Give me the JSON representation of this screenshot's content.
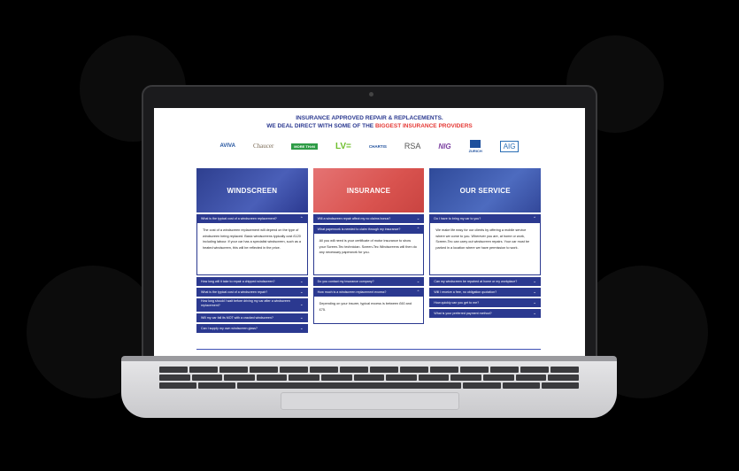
{
  "banner": {
    "line1": "INSURANCE APPROVED REPAIR & REPLACEMENTS.",
    "line2_prefix": "WE DEAL DIRECT WITH SOME OF THE",
    "line2_highlight": "BIGGEST INSURANCE PROVIDERS"
  },
  "logos": [
    {
      "label": "AVIVA",
      "color": "#1d4f9c"
    },
    {
      "label": "Chaucer",
      "color": "#7a6a55"
    },
    {
      "label": "MORE TH>N",
      "color": "#2e9c46"
    },
    {
      "label": "LV=",
      "color": "#6fbf2e"
    },
    {
      "label": "CHARTIS",
      "color": "#1d4f9c"
    },
    {
      "label": "RSA",
      "color": "#555555"
    },
    {
      "label": "NIG",
      "color": "#7b3fa0"
    },
    {
      "label": "ZURICH",
      "color": "#1d4f9c"
    },
    {
      "label": "AIG",
      "color": "#2b6fb5"
    }
  ],
  "columns": [
    {
      "title": "WINDSCREEN",
      "hero_color": "#3347a0",
      "open_question": "What is the typical cost of a windscreen replacement?",
      "answer": "The cost of a windscreen replacement will depend on the type of windscreen being replaced. Basic windscreens typically cost £120 including labour. If your car has a specialist windscreen, such as a heated windscreen, this will be reflected in the price.",
      "questions": [
        "How long will it take to repair a chipped windscreen?",
        "What is the typical cost of a windscreen repair?",
        "How long should I wait before driving my car after a windscreen replacement?",
        "Will my car fail its MOT with a cracked windscreen?",
        "Can I supply my own windscreen glass?"
      ]
    },
    {
      "title": "INSURANCE",
      "hero_color": "#e06a66",
      "pre_questions": [
        "Will a windscreen repair affect my no claims bonus?",
        "What paperwork is needed to claim through my insurance?"
      ],
      "answer": "All you will need is your certificate of motor insurance to show your Screen-Tec technician. Screen-Tec Windscreens will then do any necessary paperwork for you.",
      "questions": [
        "Do you contact my insurance company?",
        "How much is a windscreen replacement excess?"
      ],
      "answer2": "Depending on your insurer, typical excess is between £60 and £75."
    },
    {
      "title": "OUR SERVICE",
      "hero_color": "#3d5aa8",
      "open_question": "Do I have to bring my car to you?",
      "answer": "We make life easy for our clients by offering a mobile service where we come to you. Wherever you are, at home or work, Screen-Tec can carry out windscreen repairs. Your car must be parked in a location where we have permission to work.",
      "questions": [
        "Can my windscreen be repaired at home or my workplace?",
        "Will I receive a free, no obligation quotation?",
        "How quickly can you get to me?",
        "What is your preferred payment method?"
      ]
    }
  ]
}
